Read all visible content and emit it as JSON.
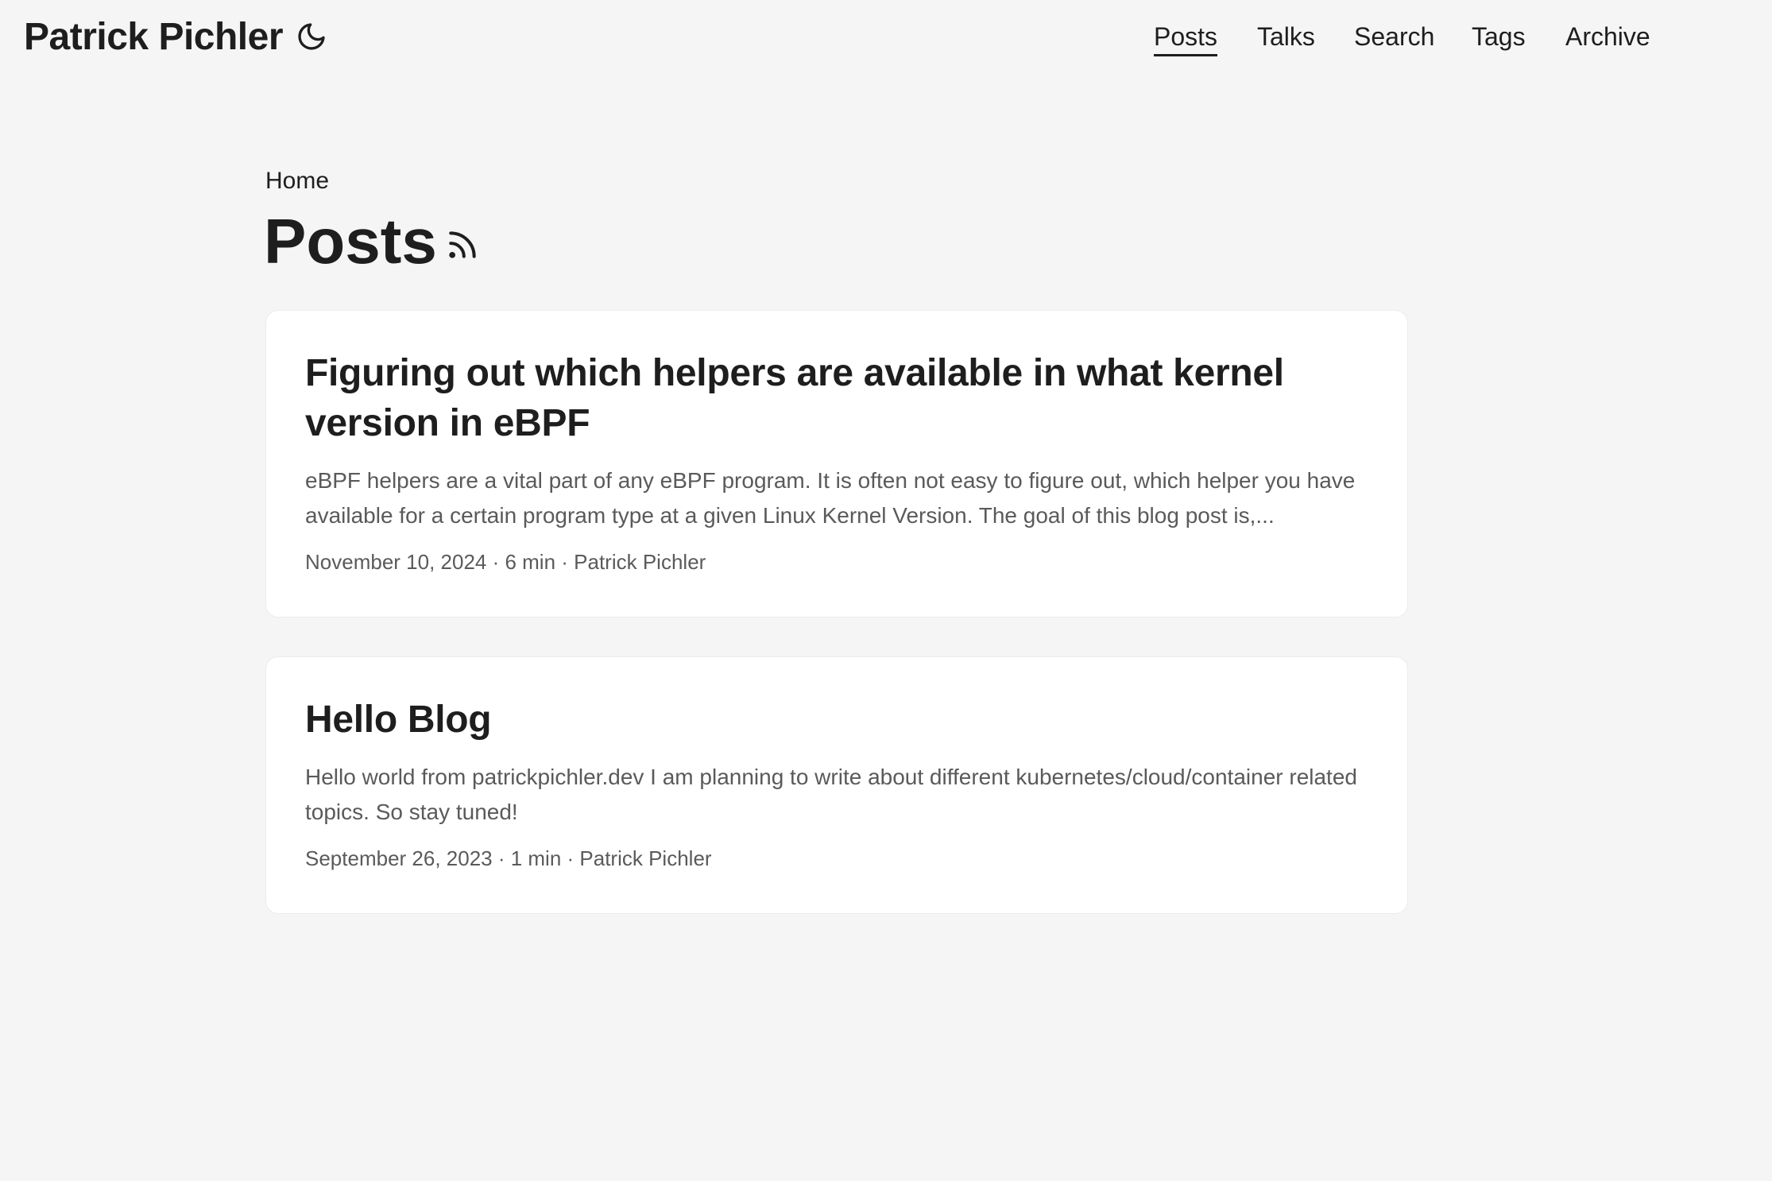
{
  "header": {
    "site_title": "Patrick Pichler",
    "theme_toggle_icon": "moon-icon",
    "nav": [
      {
        "label": "Posts",
        "active": true
      },
      {
        "label": "Talks",
        "active": false
      },
      {
        "label": "Search",
        "active": false
      },
      {
        "label": "Tags",
        "active": false
      },
      {
        "label": "Archive",
        "active": false
      }
    ]
  },
  "main": {
    "breadcrumb": "Home",
    "title": "Posts",
    "rss_icon": "rss-icon",
    "posts": [
      {
        "title": "Figuring out which helpers are available in what kernel version in eBPF",
        "excerpt": "eBPF helpers are a vital part of any eBPF program. It is often not easy to figure out, which helper you have available for a certain program type at a given Linux Kernel Version. The goal of this blog post is,...",
        "meta": "November 10, 2024 · 6 min · Patrick Pichler"
      },
      {
        "title": "Hello Blog",
        "excerpt": "Hello world from patrickpichler.dev I am planning to write about different kubernetes/cloud/container related topics. So stay tuned!",
        "meta": "September 26, 2023 · 1 min · Patrick Pichler"
      }
    ]
  }
}
